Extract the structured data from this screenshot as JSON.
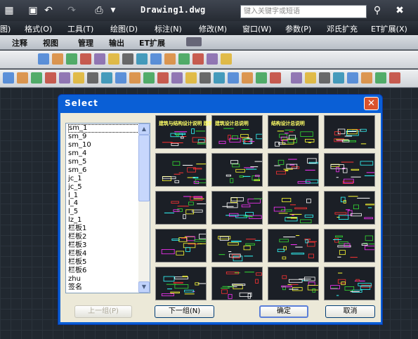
{
  "app": {
    "document_title": "Drawing1.dwg",
    "search_placeholder": "键入关键字或短语",
    "menu": [
      "格式(O)",
      "工具(T)",
      "绘图(D)",
      "标注(N)",
      "修改(M)",
      "窗口(W)",
      "参数(P)",
      "邓氏扩充",
      "ET扩展(X)"
    ],
    "menu_partial": "图)",
    "ribbon_tabs": [
      "注释",
      "视图",
      "管理",
      "输出",
      "ET扩展"
    ]
  },
  "dialog": {
    "title": "Select",
    "close_glyph": "✕",
    "list_items": [
      "sm_1",
      "sm_9",
      "sm_10",
      "sm_4",
      "sm_5",
      "sm_6",
      "jc_1",
      "jc_5",
      "l_1",
      "l_4",
      "l_5",
      "lz_1",
      "栏板1",
      "栏板2",
      "栏板3",
      "栏板4",
      "栏板5",
      "栏板6",
      "zhu",
      "签名"
    ],
    "selected_index": 0,
    "thumbnail_captions": [
      "建筑与结构设计说明 建筑与结构设计说明",
      "建筑设计总说明",
      "结构设计总说明"
    ],
    "buttons": {
      "prev": "上一组(P)",
      "next": "下一组(N)",
      "ok": "确定",
      "cancel": "取消"
    }
  },
  "colors": {
    "dialog_blue": "#0a5fd6",
    "canvas": "#212830",
    "caption_yellow": "#ffff66"
  }
}
